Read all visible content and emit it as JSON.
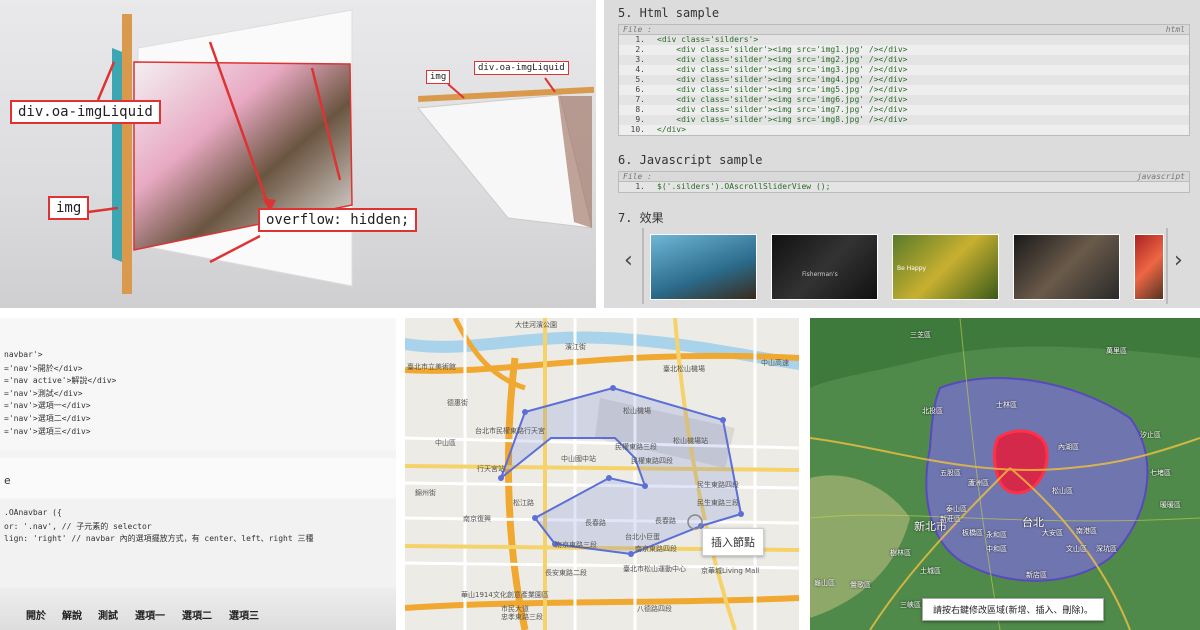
{
  "panel1": {
    "labels": {
      "imgliquid_big": "div.oa-imgLiquid",
      "img_big": "img",
      "overflow": "overflow: hidden;",
      "img_small": "img",
      "imgliquid_small": "div.oa-imgLiquid"
    }
  },
  "panel2": {
    "section5_title": "5. Html sample",
    "section6_title": "6. Javascript sample",
    "section7_title": "7. 效果",
    "file_label": "File :",
    "html_lang": "html",
    "js_lang": "javascript",
    "html_lines": [
      {
        "n": "1.",
        "code": "<div class='silders'>"
      },
      {
        "n": "2.",
        "code": "    <div class='silder'><img src='img1.jpg' /></div>"
      },
      {
        "n": "3.",
        "code": "    <div class='silder'><img src='img2.jpg' /></div>"
      },
      {
        "n": "4.",
        "code": "    <div class='silder'><img src='img3.jpg' /></div>"
      },
      {
        "n": "5.",
        "code": "    <div class='silder'><img src='img4.jpg' /></div>"
      },
      {
        "n": "6.",
        "code": "    <div class='silder'><img src='img5.jpg' /></div>"
      },
      {
        "n": "7.",
        "code": "    <div class='silder'><img src='img6.jpg' /></div>"
      },
      {
        "n": "8.",
        "code": "    <div class='silder'><img src='img7.jpg' /></div>"
      },
      {
        "n": "9.",
        "code": "    <div class='silder'><img src='img8.jpg' /></div>"
      },
      {
        "n": "10.",
        "code": "</div>"
      }
    ],
    "js_lines": [
      {
        "n": "1.",
        "code": "$('.silders').OAscrollSliderView ();"
      }
    ],
    "thumb_captions": [
      "",
      "Fisherman's",
      "Be Happy",
      "",
      ""
    ],
    "prev_arrow": "‹",
    "next_arrow": "›"
  },
  "panel3": {
    "code_top": [
      "navbar'>",
      "='nav'>開於</div>",
      "='nav active'>解說</div>",
      "='nav'>測試</div>",
      "='nav'>選項一</div>",
      "='nav'>選項二</div>",
      "='nav'>選項三</div>"
    ],
    "code_mid": "e",
    "code_bottom": [
      ".OAnavbar ({",
      "or: '.nav', // 子元素的 selector",
      "lign: 'right' // navbar 內的選項擺放方式，有 center、left、right 三種"
    ],
    "nav_items": [
      "開於",
      "解說",
      "測試",
      "選項一",
      "選項二",
      "選項三"
    ]
  },
  "panel4": {
    "labels": [
      "大佳河濱公園",
      "濱江街",
      "中山高速",
      "臺北市立美術館",
      "臺北松山機場",
      "德惠街",
      "台北市民權東路行天宮",
      "松山機場站",
      "民權東路三段",
      "中山國中站",
      "民權東路四段",
      "民生東路四段",
      "行天宮站",
      "民生東路三段",
      "長春路",
      "南京復興",
      "南京東路三段",
      "南京東路四段",
      "台北小巨蛋",
      "臺北市松山運動中心",
      "京華城Living Mall",
      "八德路四段",
      "華山1914文化創意產業園區",
      "忠孝東路三段",
      "錦州街",
      "市民大道",
      "松江路",
      "松山機場",
      "中山區",
      "長安東路二段",
      "長春路"
    ],
    "tooltip": "插入節點"
  },
  "panel5": {
    "labels": [
      "三芝區",
      "萬里區",
      "北投區",
      "士林區",
      "汐止區",
      "新北市",
      "台北",
      "內湖區",
      "松山區",
      "南港區",
      "大安區",
      "文山區",
      "板橋區",
      "新店區",
      "樹林區",
      "鶯歌區",
      "土城區",
      "三峽區",
      "七堵區",
      "暖暖區",
      "深坑區",
      "五股區",
      "蘆洲區",
      "泰山區",
      "新莊區",
      "中和區",
      "永和區",
      "龜山區"
    ],
    "hint": "請按右鍵修改區域(新增、插入、刪除)。"
  },
  "colors": {
    "accent_red": "#d33333",
    "route_blue": "#5b6fd6",
    "region_purple": "#7e6cd8"
  }
}
